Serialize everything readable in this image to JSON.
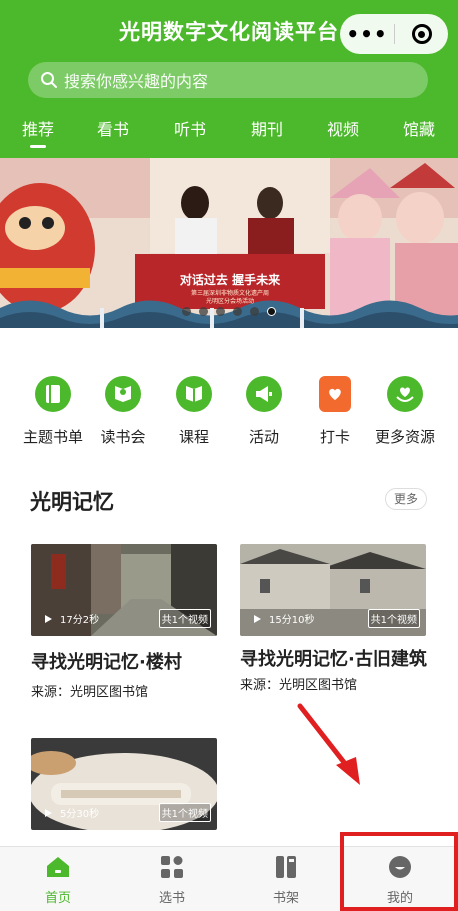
{
  "app": {
    "title": "光明数字文化阅读平台",
    "capsule_more": "•••"
  },
  "search": {
    "placeholder": "搜索你感兴趣的内容"
  },
  "tabs": [
    {
      "label": "推荐",
      "active": true
    },
    {
      "label": "看书"
    },
    {
      "label": "听书"
    },
    {
      "label": "期刊"
    },
    {
      "label": "视频"
    },
    {
      "label": "馆藏"
    }
  ],
  "banner": {
    "headline": "对话过去 握手未来",
    "subline_1": "第三届深圳非物质文化遗产周",
    "subline_2": "光明区分会场活动",
    "slide_count": 6,
    "active_slide": 6
  },
  "quick_links": [
    {
      "label": "主题书单",
      "icon": "booklist-icon"
    },
    {
      "label": "读书会",
      "icon": "reading-club-icon"
    },
    {
      "label": "课程",
      "icon": "course-icon"
    },
    {
      "label": "活动",
      "icon": "megaphone-icon"
    },
    {
      "label": "打卡",
      "icon": "checkin-calendar-icon"
    },
    {
      "label": "更多资源",
      "icon": "more-resources-icon"
    }
  ],
  "section": {
    "title": "光明记忆",
    "more_label": "更多"
  },
  "videos": [
    {
      "duration": "17分2秒",
      "count": "共1个视频",
      "title": "寻找光明记忆·楼村",
      "source": "来源：光明区图书馆"
    },
    {
      "duration": "15分10秒",
      "count": "共1个视频",
      "title": "寻找光明记忆·古旧建筑",
      "source": "来源：光明区图书馆"
    },
    {
      "duration": "5分30秒",
      "count": "共1个视频",
      "title": "",
      "source": ""
    }
  ],
  "bottom_nav": [
    {
      "label": "首页",
      "icon": "home-icon",
      "active": true
    },
    {
      "label": "选书",
      "icon": "grid-icon"
    },
    {
      "label": "书架",
      "icon": "bookshelf-icon"
    },
    {
      "label": "我的",
      "icon": "profile-icon"
    }
  ],
  "colors": {
    "brand_green": "#4cb82b",
    "annotation_red": "#e02020",
    "checkin_orange": "#f26a2e"
  }
}
